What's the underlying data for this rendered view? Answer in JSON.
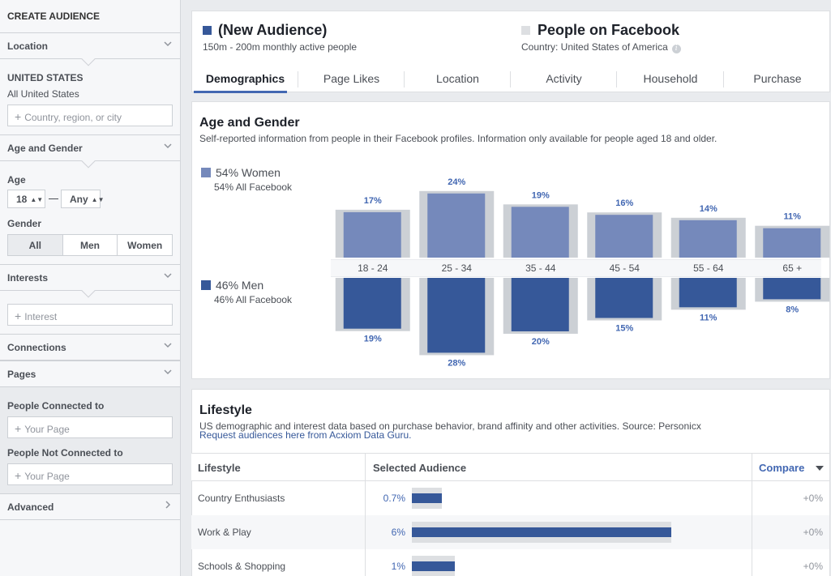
{
  "sidebar": {
    "title": "CREATE AUDIENCE",
    "sections": {
      "location": "Location",
      "age_gender": "Age and Gender",
      "interests": "Interests",
      "connections": "Connections",
      "pages": "Pages",
      "advanced": "Advanced"
    },
    "location": {
      "country": "UNITED STATES",
      "region": "All United States",
      "placeholder": "Country, region, or city"
    },
    "age": {
      "label": "Age",
      "min": "18",
      "max": "Any"
    },
    "gender": {
      "label": "Gender",
      "options": [
        "All",
        "Men",
        "Women"
      ],
      "selected": "All"
    },
    "interests": {
      "placeholder": "Interest"
    },
    "pages": {
      "connected_label": "People Connected to",
      "connected_placeholder": "Your Page",
      "not_connected_label": "People Not Connected to",
      "not_connected_placeholder": "Your Page"
    }
  },
  "header": {
    "audience": {
      "title": "(New Audience)",
      "subtitle": "150m - 200m monthly active people"
    },
    "comparison": {
      "title": "People on Facebook",
      "subtitle": "Country: United States of America"
    },
    "tabs": [
      "Demographics",
      "Page Likes",
      "Location",
      "Activity",
      "Household",
      "Purchase"
    ],
    "active_tab": "Demographics"
  },
  "age_gender": {
    "title": "Age and Gender",
    "description": "Self-reported information from people in their Facebook profiles. Information only available for people aged 18 and older.",
    "women": {
      "label": "54% Women",
      "sub": "54% All Facebook"
    },
    "men": {
      "label": "46% Men",
      "sub": "46% All Facebook"
    }
  },
  "chart_data": {
    "type": "bar",
    "categories": [
      "18 - 24",
      "25 - 34",
      "35 - 44",
      "45 - 54",
      "55 - 64",
      "65 +"
    ],
    "series": [
      {
        "name": "54% Women",
        "values": [
          17,
          24,
          19,
          16,
          14,
          11
        ],
        "labels": [
          "17%",
          "24%",
          "19%",
          "16%",
          "14%",
          "11%"
        ],
        "color": "#7589bb",
        "direction": "up"
      },
      {
        "name": "46% Men",
        "values": [
          19,
          28,
          20,
          15,
          11,
          8
        ],
        "labels": [
          "19%",
          "28%",
          "20%",
          "15%",
          "11%",
          "8%"
        ],
        "color": "#365899",
        "direction": "down"
      }
    ],
    "benchmark": {
      "women": [
        17,
        24,
        19,
        16,
        14,
        11
      ],
      "men": [
        19,
        28,
        20,
        15,
        11,
        8
      ],
      "color": "#ccd0d5"
    },
    "title": "Age and Gender",
    "unit": "%"
  },
  "lifestyle": {
    "title": "Lifestyle",
    "description": "US demographic and interest data based on purchase behavior, brand affinity and other activities. Source: Personicx",
    "link": "Request audiences here from Acxiom Data Guru.",
    "columns": {
      "name": "Lifestyle",
      "selected": "Selected Audience",
      "compare": "Compare"
    },
    "rows": [
      {
        "name": "Country Enthusiasts",
        "pct": "0.7%",
        "value": 0.7,
        "compare": "+0%"
      },
      {
        "name": "Work & Play",
        "pct": "6%",
        "value": 6,
        "compare": "+0%"
      },
      {
        "name": "Schools & Shopping",
        "pct": "1%",
        "value": 1,
        "compare": "+0%"
      }
    ],
    "scale_max": 6
  },
  "colors": {
    "accent": "#4267b2",
    "dark_blue": "#365899",
    "light_blue": "#7589bb",
    "grey_square": "#dddfe2"
  }
}
